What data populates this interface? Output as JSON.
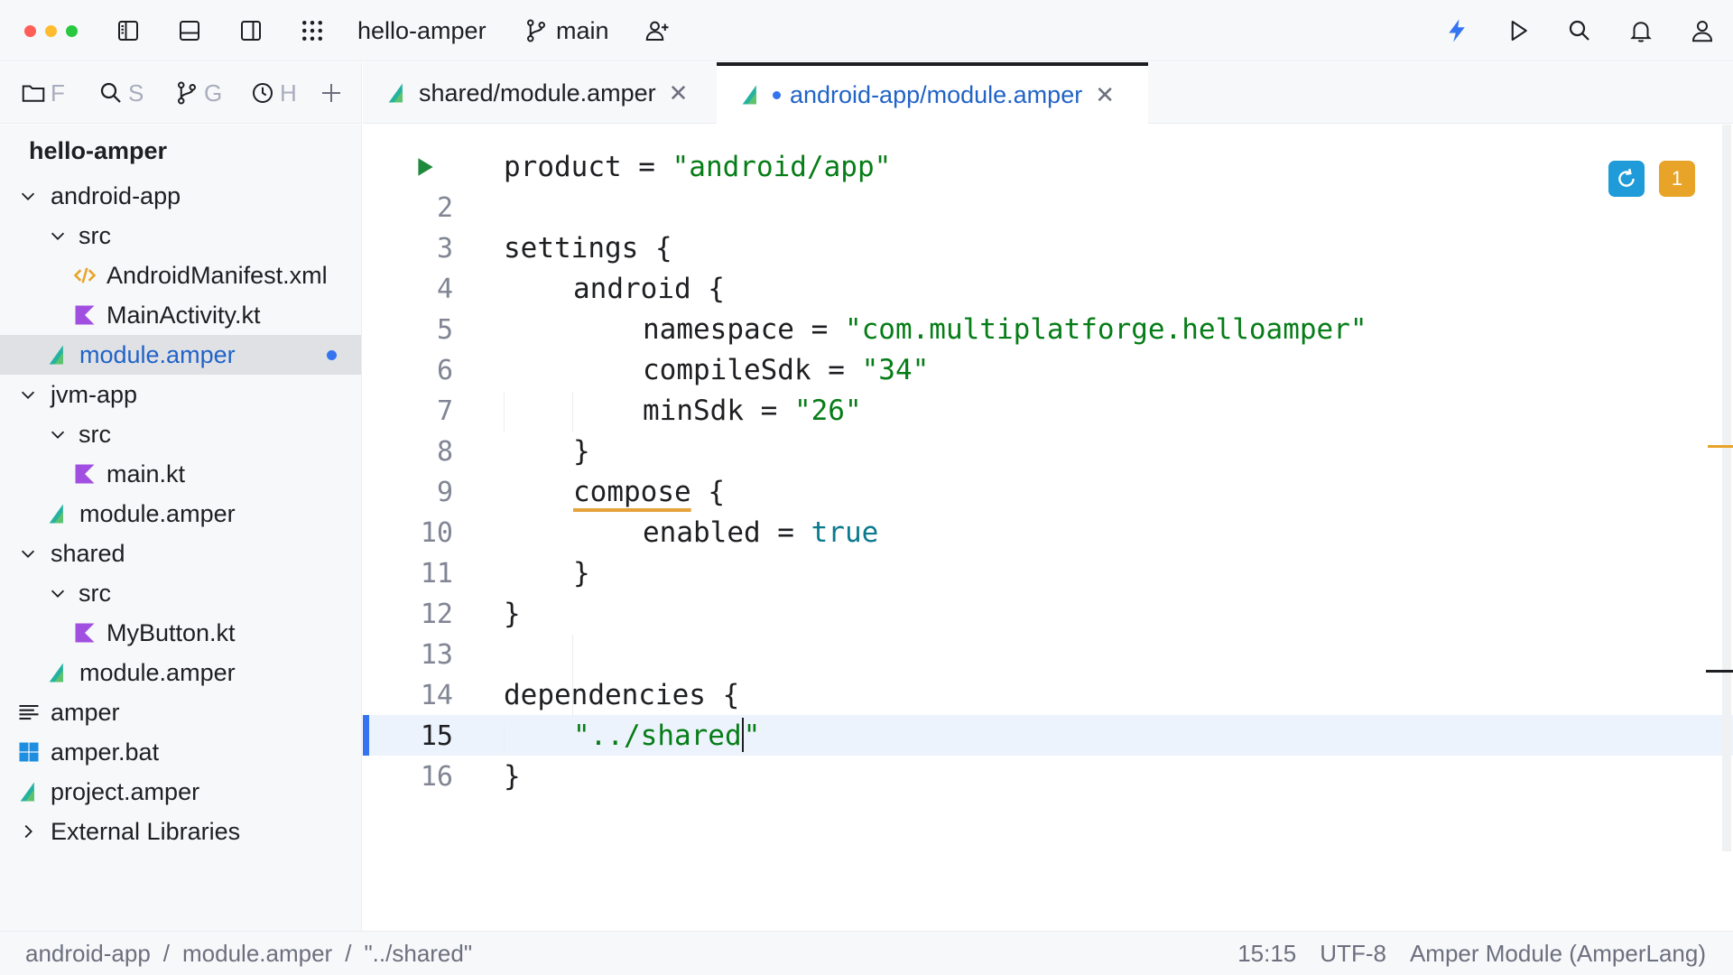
{
  "titlebar": {
    "project_name": "hello-amper",
    "branch": "main"
  },
  "tool_tabs": [
    {
      "icon": "folder-icon",
      "label": "F"
    },
    {
      "icon": "search-icon",
      "label": "S"
    },
    {
      "icon": "git-branch-icon",
      "label": "G"
    },
    {
      "icon": "clock-icon",
      "label": "H"
    }
  ],
  "editor_tabs": [
    {
      "label": "shared/module.amper",
      "active": false,
      "modified": false
    },
    {
      "label": "android-app/module.amper",
      "active": true,
      "modified": true
    }
  ],
  "project_tree": {
    "root": "hello-amper",
    "items": [
      {
        "label": "android-app",
        "type": "folder",
        "expanded": true
      },
      {
        "label": "src",
        "type": "folder",
        "expanded": true
      },
      {
        "label": "AndroidManifest.xml",
        "type": "xml"
      },
      {
        "label": "MainActivity.kt",
        "type": "kotlin"
      },
      {
        "label": "module.amper",
        "type": "amper",
        "selected": true,
        "modified": true
      },
      {
        "label": "jvm-app",
        "type": "folder",
        "expanded": true
      },
      {
        "label": "src",
        "type": "folder",
        "expanded": true
      },
      {
        "label": "main.kt",
        "type": "kotlin"
      },
      {
        "label": "module.amper",
        "type": "amper"
      },
      {
        "label": "shared",
        "type": "folder",
        "expanded": true
      },
      {
        "label": "src",
        "type": "folder",
        "expanded": true
      },
      {
        "label": "MyButton.kt",
        "type": "kotlin"
      },
      {
        "label": "module.amper",
        "type": "amper"
      },
      {
        "label": "amper",
        "type": "text"
      },
      {
        "label": "amper.bat",
        "type": "bat"
      },
      {
        "label": "project.amper",
        "type": "amper"
      },
      {
        "label": "External Libraries",
        "type": "folder",
        "expanded": false
      }
    ]
  },
  "editor": {
    "line_numbers": [
      "2",
      "3",
      "4",
      "5",
      "6",
      "7",
      "8",
      "9",
      "10",
      "11",
      "12",
      "13",
      "14",
      "15",
      "16"
    ],
    "current_line": "15",
    "problems_count": "1",
    "code": {
      "l1_key": "product = ",
      "l1_val": "\"android/app\"",
      "l3": "settings {",
      "l4": "android {",
      "l5_key": "namespace = ",
      "l5_val": "\"com.multiplatforge.helloamper\"",
      "l6_key": "compileSdk = ",
      "l6_val": "\"34\"",
      "l7_key": "minSdk = ",
      "l7_val": "\"26\"",
      "l8": "}",
      "l9_kw": "compose",
      "l9_rest": " {",
      "l10_key": "enabled = ",
      "l10_val": "true",
      "l11": "}",
      "l12": "}",
      "l14": "dependencies {",
      "l15_before": "\"../shared",
      "l15_after": "\"",
      "l16": "}"
    }
  },
  "statusbar": {
    "breadcrumb": [
      "android-app",
      "module.amper",
      "\"../shared\""
    ],
    "separator": "/",
    "position": "15:15",
    "encoding": "UTF-8",
    "file_type": "Amper Module (AmperLang)"
  },
  "colors": {
    "accent": "#3574f0",
    "string": "#067d17",
    "keyword": "#0b7a8e",
    "warning": "#e8a429"
  }
}
